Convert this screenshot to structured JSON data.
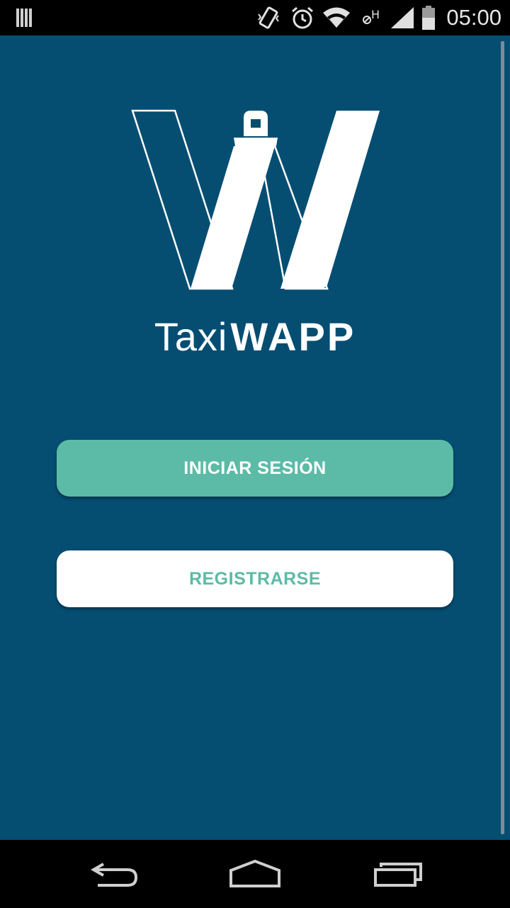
{
  "status_bar": {
    "time": "05:00",
    "icons": [
      "notification-bars-icon",
      "vibrate-icon",
      "alarm-icon",
      "wifi-icon",
      "no-hspa-icon",
      "signal-icon",
      "battery-icon"
    ]
  },
  "app": {
    "brand_light": "Taxi",
    "brand_bold": "WAPP",
    "background_color": "#054e72",
    "accent_color": "#5cbba6"
  },
  "buttons": {
    "login_label": "INICIAR SESIÓN",
    "register_label": "REGISTRARSE"
  },
  "nav_bar": {
    "icons": [
      "back-icon",
      "home-icon",
      "recents-icon"
    ]
  }
}
